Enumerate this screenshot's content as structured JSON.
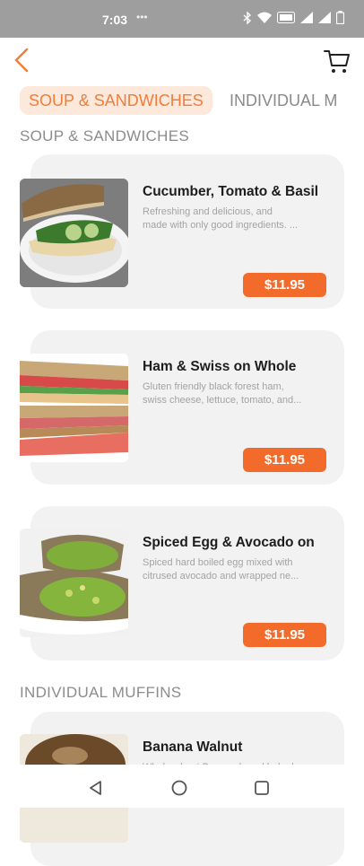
{
  "status_bar": {
    "time": "7:03",
    "dots": "•••",
    "icons": [
      "bluetooth-icon",
      "wifi-icon",
      "volte-icon",
      "signal-icon",
      "signal-icon",
      "battery-icon"
    ]
  },
  "header": {
    "back_icon": "chevron-left-icon",
    "cart_icon": "shopping-cart-icon",
    "accent_color": "#f07d3a"
  },
  "tabs": [
    {
      "label": "SOUP & SANDWICHES",
      "active": true
    },
    {
      "label": "INDIVIDUAL M",
      "active": false
    }
  ],
  "sections": [
    {
      "title": "SOUP & SANDWICHES",
      "items": [
        {
          "name": "Cucumber, Tomato & Basil",
          "description_line1": "Refreshing and delicious, and",
          "description_line2": "made with only good ingredients. ...",
          "price": "$11.95"
        },
        {
          "name": "Ham & Swiss on Whole",
          "description_line1": "Gluten friendly black forest ham,",
          "description_line2": "swiss cheese, lettuce, tomato, and...",
          "price": "$11.95"
        },
        {
          "name": "Spiced Egg & Avocado on",
          "description_line1": "Spiced hard boiled egg mixed with",
          "description_line2": "citrused avocado and wrapped ne...",
          "price": "$11.95"
        }
      ]
    },
    {
      "title": "INDIVIDUAL MUFFINS",
      "items": [
        {
          "name": "Banana Walnut",
          "description_line1": "Whole wheat Banana bread baked",
          "description_line2": "",
          "price": ""
        }
      ]
    }
  ],
  "nav_bar": {
    "icons": [
      "back-triangle-icon",
      "home-circle-icon",
      "recents-square-icon"
    ]
  }
}
